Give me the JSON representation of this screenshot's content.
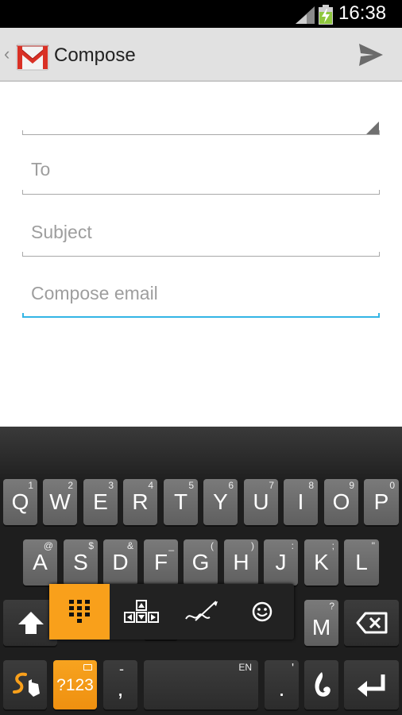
{
  "status_bar": {
    "time": "16:38",
    "icons": [
      "signal-icon",
      "battery-charging-icon"
    ]
  },
  "action_bar": {
    "title": "Compose",
    "icons": [
      "up-caret-icon",
      "gmail-logo-icon",
      "send-icon"
    ]
  },
  "form": {
    "to_placeholder": "To",
    "subject_placeholder": "Subject",
    "body_placeholder": "Compose email"
  },
  "keyboard": {
    "row1": [
      {
        "label": "Q",
        "hint": "1"
      },
      {
        "label": "W",
        "hint": "2"
      },
      {
        "label": "E",
        "hint": "3"
      },
      {
        "label": "R",
        "hint": "4"
      },
      {
        "label": "T",
        "hint": "5"
      },
      {
        "label": "Y",
        "hint": "6"
      },
      {
        "label": "U",
        "hint": "7"
      },
      {
        "label": "I",
        "hint": "8"
      },
      {
        "label": "O",
        "hint": "9"
      },
      {
        "label": "P",
        "hint": "0"
      }
    ],
    "row2": [
      {
        "label": "A",
        "hint": "@"
      },
      {
        "label": "S",
        "hint": "$"
      },
      {
        "label": "D",
        "hint": "&"
      },
      {
        "label": "F",
        "hint": "_"
      },
      {
        "label": "G",
        "hint": "("
      },
      {
        "label": "H",
        "hint": ")"
      },
      {
        "label": "J",
        "hint": ":"
      },
      {
        "label": "K",
        "hint": ";"
      },
      {
        "label": "L",
        "hint": "\""
      }
    ],
    "row3": {
      "m_label": "M",
      "m_hint": "?"
    },
    "row4": {
      "sym_label": "?123",
      "comma_label": ",",
      "comma_hint": "-",
      "space_hint": "EN",
      "period_label": ".",
      "period_hint": "'"
    },
    "icons": [
      "shift-icon",
      "backspace-icon",
      "swype-icon",
      "dragon-icon",
      "enter-icon"
    ],
    "popup_icons": [
      "number-pad-icon",
      "cursor-arrows-icon",
      "handwriting-icon",
      "emoji-icon"
    ],
    "accent_color": "#f9a01b"
  }
}
